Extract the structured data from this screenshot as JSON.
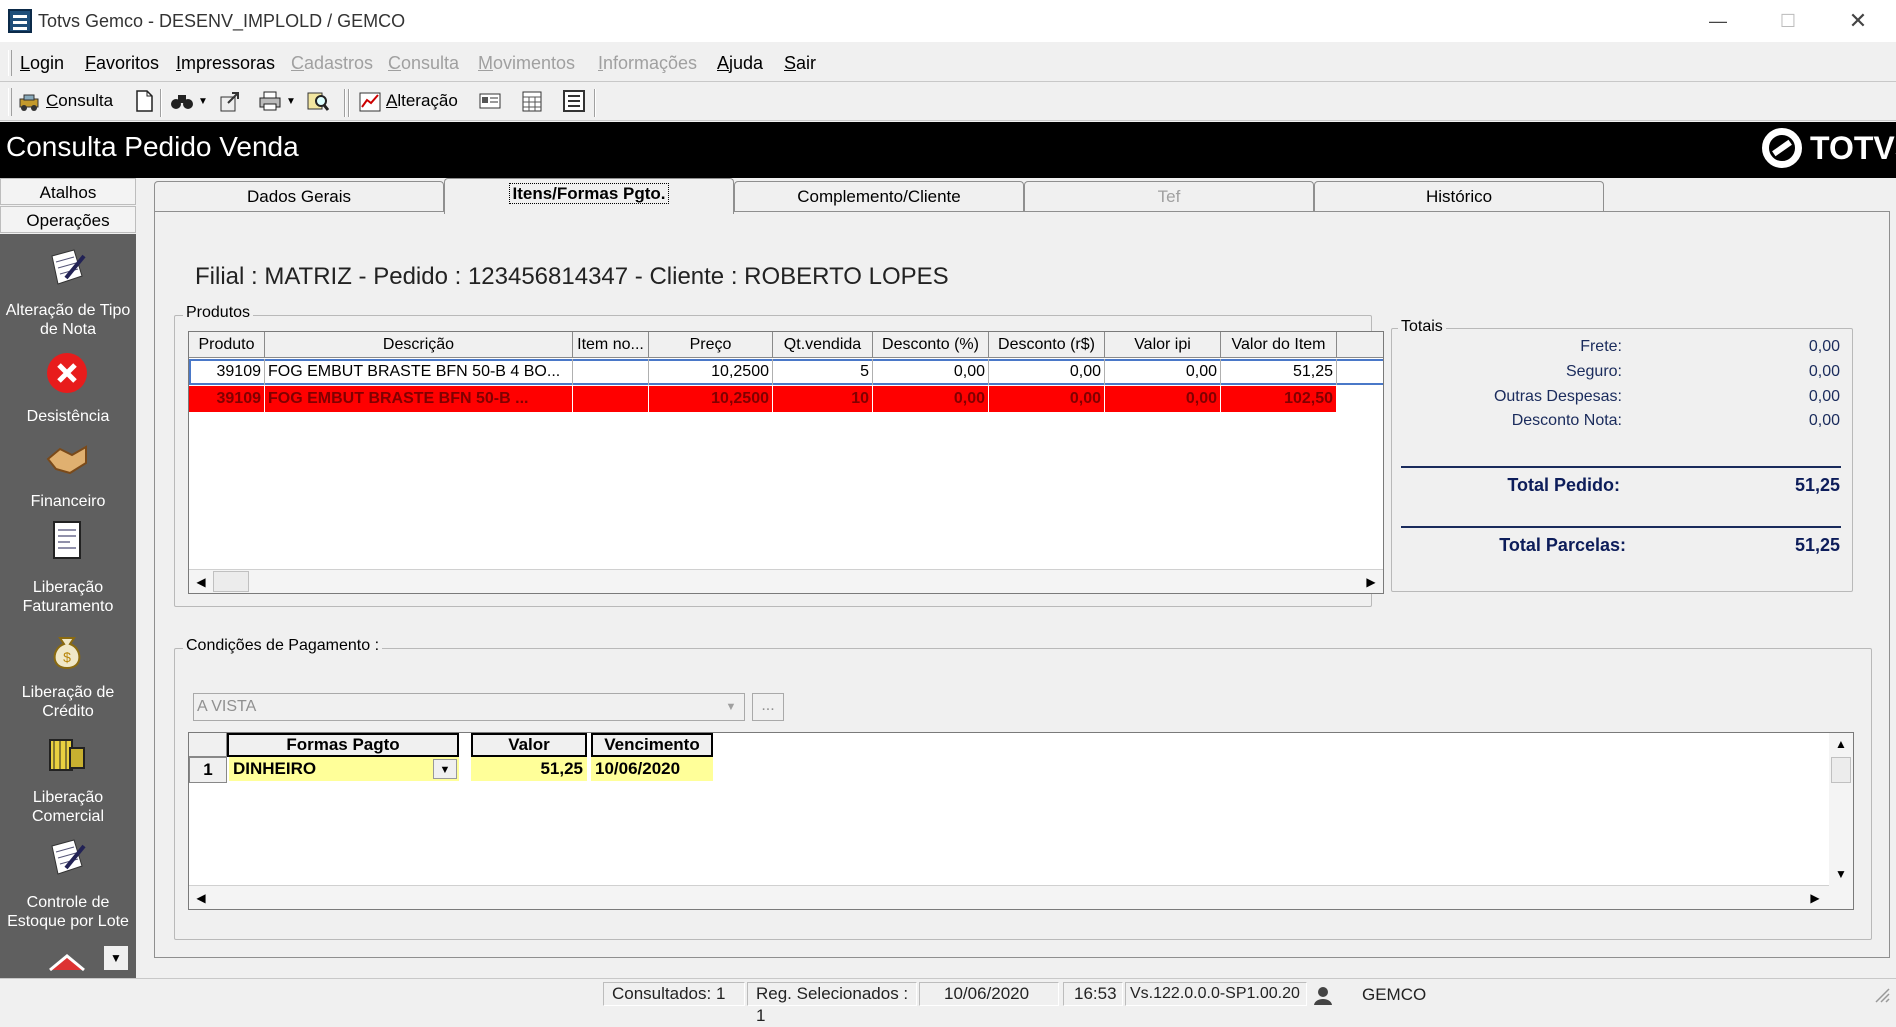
{
  "window": {
    "title": "Totvs Gemco - DESENV_IMPLOLD / GEMCO"
  },
  "menu": {
    "items": [
      {
        "label": "Login",
        "enabled": true
      },
      {
        "label": "Favoritos",
        "enabled": true
      },
      {
        "label": "Impressoras",
        "enabled": true
      },
      {
        "label": "Cadastros",
        "enabled": false
      },
      {
        "label": "Consulta",
        "enabled": false
      },
      {
        "label": "Movimentos",
        "enabled": false
      },
      {
        "label": "Informações",
        "enabled": false
      },
      {
        "label": "Ajuda",
        "enabled": true
      },
      {
        "label": "Sair",
        "enabled": true
      }
    ]
  },
  "toolbar": {
    "consulta_label": "Consulta",
    "alteracao_label": "Alteração"
  },
  "header": {
    "title": "Consulta Pedido Venda",
    "logo": "TOTVS"
  },
  "sidebar": {
    "atalhos": "Atalhos",
    "operacoes": "Operações",
    "items": [
      {
        "label": "Alteração de Tipo de Nota",
        "icon": "pen-document-icon"
      },
      {
        "label": "Desistência",
        "icon": "red-x-icon"
      },
      {
        "label": "Financeiro",
        "icon": "handshake-icon"
      },
      {
        "label": "Liberação Faturamento",
        "icon": "invoice-icon"
      },
      {
        "label": "Liberação de Crédito",
        "icon": "money-bag-icon"
      },
      {
        "label": "Liberação Comercial",
        "icon": "boxes-icon"
      },
      {
        "label": "Controle de Estoque por Lote",
        "icon": "pen-document-icon"
      }
    ]
  },
  "tabs": [
    {
      "label": "Dados Gerais",
      "active": false,
      "enabled": true
    },
    {
      "label": "Itens/Formas Pgto.",
      "active": true,
      "enabled": true
    },
    {
      "label": "Complemento/Cliente",
      "active": false,
      "enabled": true
    },
    {
      "label": "Tef",
      "active": false,
      "enabled": false
    },
    {
      "label": "Histórico",
      "active": false,
      "enabled": true
    }
  ],
  "info_line": "Filial : MATRIZ - Pedido : 123456814347 -  Cliente : ROBERTO LOPES",
  "produtos": {
    "group_title": "Produtos",
    "columns": [
      "Produto",
      "Descrição",
      "Item no...",
      "Preço",
      "Qt.vendida",
      "Desconto (%)",
      "Desconto (r$)",
      "Valor ipi",
      "Valor do Item"
    ],
    "rows": [
      {
        "produto": "39109",
        "descricao": "FOG EMBUT BRASTE BFN 50-B 4 BO...",
        "item_no": "",
        "preco": "10,2500",
        "qt": "5",
        "desc_pct": "0,00",
        "desc_rs": "0,00",
        "ipi": "0,00",
        "valor": "51,25",
        "highlight": false
      },
      {
        "produto": "39109",
        "descricao": "FOG EMBUT BRASTE BFN 50-B ...",
        "item_no": "",
        "preco": "10,2500",
        "qt": "10",
        "desc_pct": "0,00",
        "desc_rs": "0,00",
        "ipi": "0,00",
        "valor": "102,50",
        "highlight": true
      }
    ]
  },
  "totais": {
    "group_title": "Totais",
    "frete_label": "Frete:",
    "frete": "0,00",
    "seguro_label": "Seguro:",
    "seguro": "0,00",
    "outras_label": "Outras Despesas:",
    "outras": "0,00",
    "desconto_label": "Desconto Nota:",
    "desconto": "0,00",
    "total_pedido_label": "Total Pedido:",
    "total_pedido": "51,25",
    "total_parcelas_label": "Total Parcelas:",
    "total_parcelas": "51,25"
  },
  "pagamento": {
    "group_title": "Condições de Pagamento :",
    "condicao": "A VISTA",
    "ellipsis": "...",
    "columns": [
      "Formas Pagto",
      "Valor",
      "Vencimento"
    ],
    "rows": [
      {
        "num": "1",
        "forma": "DINHEIRO",
        "valor": "51,25",
        "vencimento": "10/06/2020"
      }
    ]
  },
  "status": {
    "consultados": "Consultados: 1",
    "selecionados": "Reg. Selecionados : 1",
    "date": "10/06/2020",
    "time": "16:53",
    "version": "Vs.122.0.0.0-SP1.00.20",
    "user": "GEMCO"
  }
}
